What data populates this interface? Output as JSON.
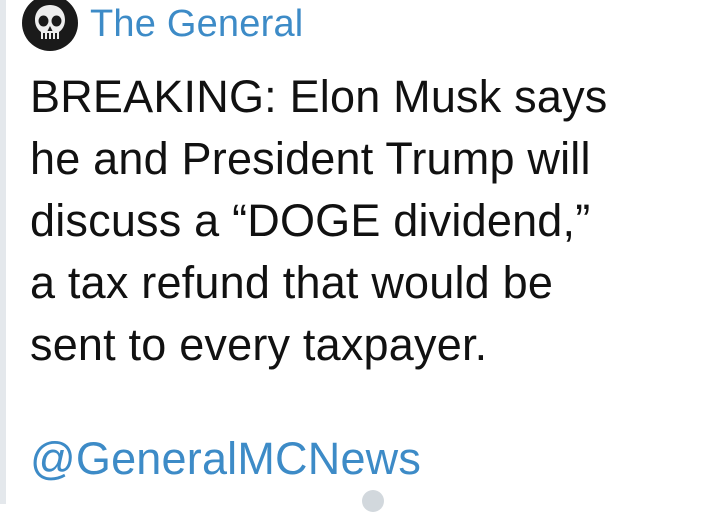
{
  "channel": {
    "name": "The General",
    "name_color": "#3d8bc7"
  },
  "message": {
    "lines": [
      "BREAKING: Elon Musk says",
      "he and President Trump will",
      "discuss a “DOGE dividend,”",
      "a tax refund that would be",
      "sent to every taxpayer."
    ],
    "handle": "@GeneralMCNews"
  },
  "icons": {
    "avatar": "punisher-skull-icon",
    "footer": "views-icon"
  },
  "footer": {
    "views_text": ""
  }
}
